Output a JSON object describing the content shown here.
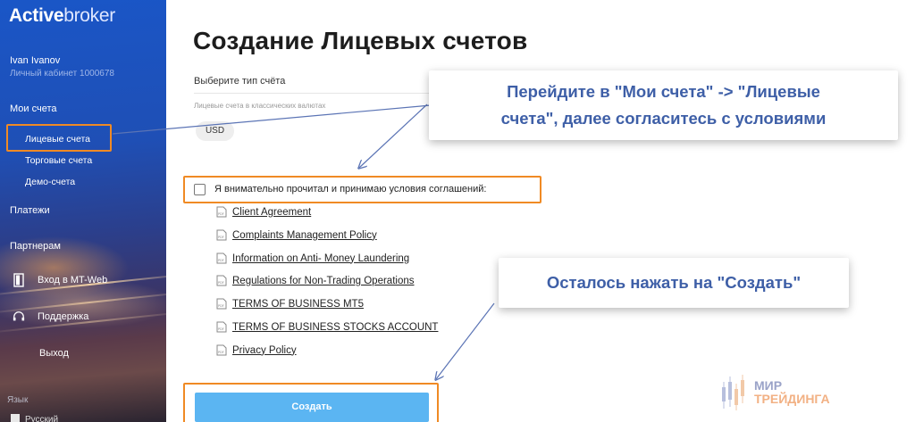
{
  "brand": {
    "logo_bold": "Active",
    "logo_light": "broker"
  },
  "user": {
    "name": "Ivan Ivanov",
    "cabinet": "Личный кабинет 1000678"
  },
  "sidebar": {
    "my_accounts": "Мои счета",
    "items": [
      {
        "label": "Лицевые счета"
      },
      {
        "label": "Торговые счета"
      },
      {
        "label": "Демо-счета"
      }
    ],
    "payments": "Платежи",
    "partners": "Партнерам",
    "mt_web": "Вход в MT-Web",
    "support": "Поддержка",
    "logout": "Выход",
    "language_label": "Язык",
    "language_value": "Русский"
  },
  "main": {
    "title": "Создание Лицевых счетов",
    "type_label": "Выберите тип счёта",
    "classic_label": "Лицевые счета в классических валютах",
    "currency": "USD",
    "agree_text": "Я внимательно прочитал и принимаю условия соглашений:",
    "documents": [
      "Client Agreement",
      "Complaints Management Policy",
      "Information on Anti- Money Laundering",
      "Regulations for Non-Trading Operations",
      "TERMS OF BUSINESS MT5",
      "TERMS OF BUSINESS STOCKS ACCOUNT",
      "Privacy Policy"
    ],
    "create_button": "Создать"
  },
  "callouts": {
    "first_line1": "Перейдите в \"Мои счета\" -> \"Лицевые",
    "first_line2": "счета\", далее согласитесь с условиями",
    "second": "Осталось нажать на \"Создать\""
  },
  "watermark": {
    "line1": "МИР",
    "line2": "ТРЕЙДИНГА"
  },
  "colors": {
    "accent_orange": "#f08a24",
    "button_blue": "#5bb5f2",
    "callout_text": "#3e5fa7"
  }
}
